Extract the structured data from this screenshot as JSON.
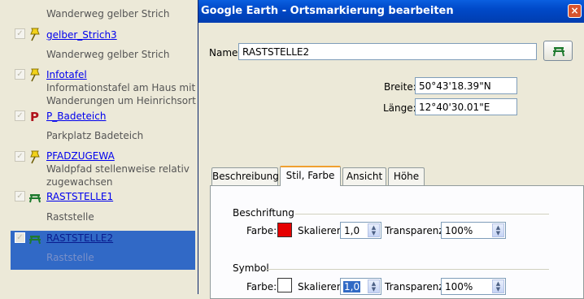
{
  "places": {
    "items": [
      {
        "title": "",
        "desc": "Wanderweg gelber Strich",
        "icon": "none"
      },
      {
        "title": "gelber_Strich3",
        "desc": "Wanderweg gelber Strich",
        "icon": "yellow-pushpin-icon"
      },
      {
        "title": "Infotafel",
        "desc": "Informationstafel am Haus mit Wanderungen um Heinrichsort",
        "icon": "yellow-pushpin-icon"
      },
      {
        "title": "P_Badeteich",
        "desc": "Parkplatz Badeteich",
        "icon": "parking-icon"
      },
      {
        "title": "PFADZUGEWA",
        "desc": "Waldpfad stellenweise relativ zugewachsen",
        "icon": "yellow-pushpin-icon"
      },
      {
        "title": "RASTSTELLE1",
        "desc": "Raststelle",
        "icon": "picnic-table-icon"
      },
      {
        "title": "RASTSTELLE2",
        "desc": "Raststelle",
        "icon": "picnic-table-icon",
        "selected": true
      }
    ]
  },
  "dialog": {
    "title": "Google Earth - Ortsmarkierung bearbeiten",
    "close_label": "×",
    "name_label": "Name:",
    "name_value": "RASTSTELLE2",
    "latitude_label": "Breite:",
    "latitude_value": "50°43'18.39\"N",
    "longitude_label": "Länge:",
    "longitude_value": "12°40'30.01\"E",
    "tabs": [
      "Beschreibung",
      "Stil, Farbe",
      "Ansicht",
      "Höhe"
    ],
    "active_tab": "Stil, Farbe",
    "label_group": {
      "heading": "Beschriftung",
      "color_label": "Farbe:",
      "color": "#E60000",
      "scale_label": "Skalieren:",
      "scale_value": "1,0",
      "opacity_label": "Transparenz:",
      "opacity_value": "100%"
    },
    "symbol_group": {
      "heading": "Symbol",
      "color_label": "Farbe:",
      "color": "#FFFFFF",
      "scale_label": "Skalieren:",
      "scale_value": "1,0",
      "opacity_label": "Transparenz:",
      "opacity_value": "100%"
    }
  },
  "colors": {
    "selection": "#3169C6",
    "link": "#0000EE",
    "titlebar": "#0049C8",
    "active_tab_accent": "#F0A030"
  }
}
